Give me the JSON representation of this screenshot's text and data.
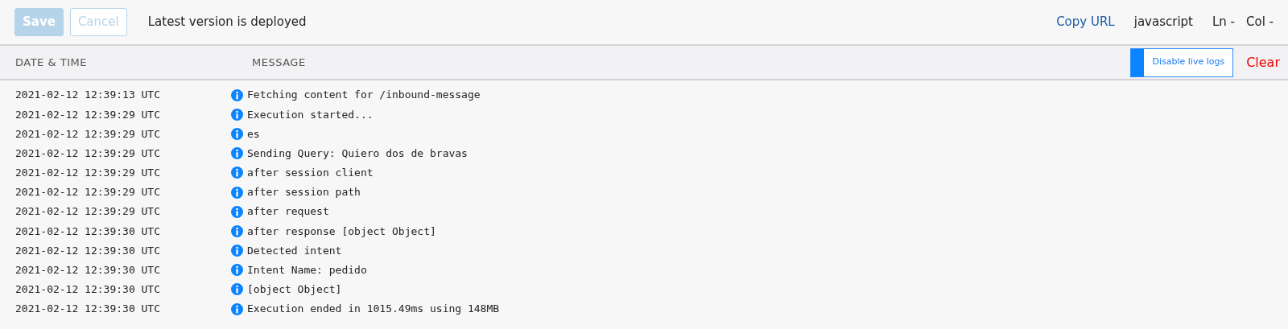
{
  "toolbar": {
    "save": {
      "label": "Save",
      "disabled": true
    },
    "cancel": {
      "label": "Cancel",
      "disabled": true
    },
    "status": "Latest version is deployed",
    "copy_url": "Copy URL",
    "language": "javascript",
    "line": "Ln -",
    "column": "Col -"
  },
  "log_header": {
    "columns": [
      "DATE & TIME",
      "MESSAGE"
    ],
    "live_toggle": {
      "label": "Disable live logs",
      "on": true
    },
    "clear": "Clear"
  },
  "logs": [
    {
      "time": "2021-02-12 12:39:13 UTC",
      "kind": "info",
      "message": "Fetching content for /inbound-message"
    },
    {
      "time": "2021-02-12 12:39:29 UTC",
      "kind": "info",
      "message": "Execution started..."
    },
    {
      "time": "2021-02-12 12:39:29 UTC",
      "kind": "info",
      "message": "es"
    },
    {
      "time": "2021-02-12 12:39:29 UTC",
      "kind": "info",
      "message": "Sending Query: Quiero dos de bravas"
    },
    {
      "time": "2021-02-12 12:39:29 UTC",
      "kind": "info",
      "message": "after session client"
    },
    {
      "time": "2021-02-12 12:39:29 UTC",
      "kind": "info",
      "message": "after session path"
    },
    {
      "time": "2021-02-12 12:39:29 UTC",
      "kind": "info",
      "message": "after request"
    },
    {
      "time": "2021-02-12 12:39:30 UTC",
      "kind": "info",
      "message": "after response [object Object]"
    },
    {
      "time": "2021-02-12 12:39:30 UTC",
      "kind": "info",
      "message": "Detected intent"
    },
    {
      "time": "2021-02-12 12:39:30 UTC",
      "kind": "info",
      "message": "Intent Name: pedido"
    },
    {
      "time": "2021-02-12 12:39:30 UTC",
      "kind": "info",
      "message": "[object Object]"
    },
    {
      "time": "2021-02-12 12:39:30 UTC",
      "kind": "info",
      "message": "Execution ended in 1015.49ms using 148MB"
    }
  ]
}
